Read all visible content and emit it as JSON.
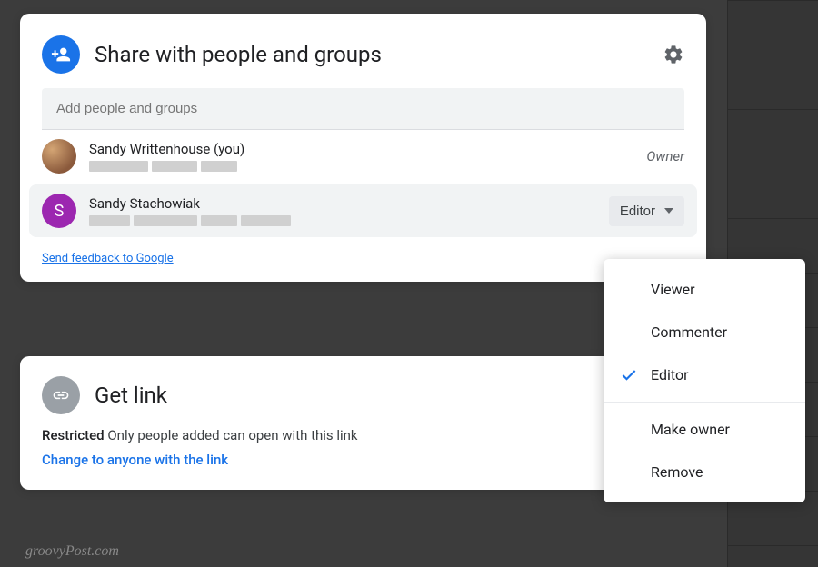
{
  "share": {
    "title": "Share with people and groups",
    "add_placeholder": "Add people and groups",
    "people": [
      {
        "name": "Sandy Writtenhouse (you)",
        "role": "Owner"
      },
      {
        "name": "Sandy Stachowiak",
        "role": "Editor",
        "initial": "S"
      }
    ],
    "feedback": "Send feedback to Google"
  },
  "link": {
    "title": "Get link",
    "restricted_label": "Restricted",
    "restricted_text": " Only people added can open with this link",
    "change": "Change to anyone with the link"
  },
  "menu": {
    "options": [
      "Viewer",
      "Commenter",
      "Editor"
    ],
    "selected": "Editor",
    "actions": [
      "Make owner",
      "Remove"
    ]
  },
  "watermark": "groovyPost.com"
}
